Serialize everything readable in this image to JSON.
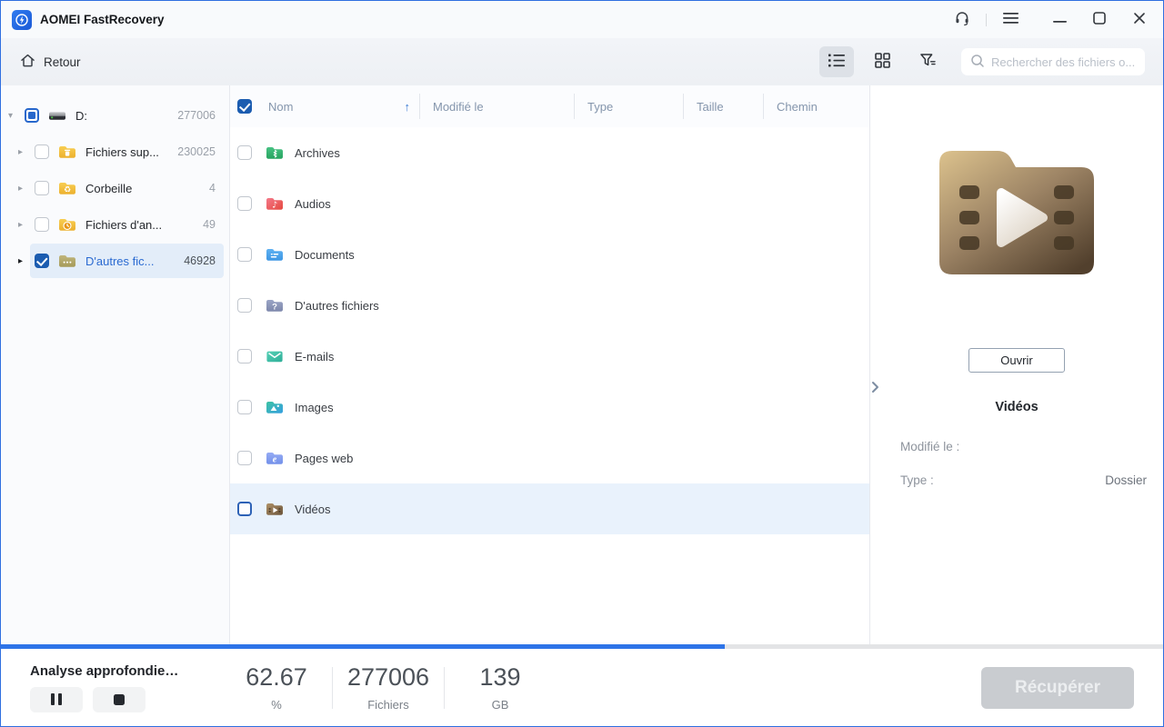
{
  "window": {
    "title": "AOMEI FastRecovery"
  },
  "toolbar": {
    "back_label": "Retour",
    "search_placeholder": "Rechercher des fichiers o..."
  },
  "sidebar": {
    "items": [
      {
        "label": "D:",
        "count": "277006",
        "icon": "drive-icon",
        "checkbox": "indeterminate",
        "expanded": true
      },
      {
        "label": "Fichiers sup...",
        "count": "230025",
        "icon": "deleted-folder-icon",
        "checkbox": "unchecked",
        "expanded": false
      },
      {
        "label": "Corbeille",
        "count": "4",
        "icon": "recycle-folder-icon",
        "checkbox": "unchecked",
        "expanded": false
      },
      {
        "label": "Fichiers d'an...",
        "count": "49",
        "icon": "history-folder-icon",
        "checkbox": "unchecked",
        "expanded": false
      },
      {
        "label": "D'autres fic...",
        "count": "46928",
        "icon": "other-folder-icon",
        "checkbox": "checked",
        "expanded": false,
        "selected": true
      }
    ]
  },
  "list": {
    "columns": {
      "nom": "Nom",
      "modifie": "Modifié le",
      "type": "Type",
      "taille": "Taille",
      "chemin": "Chemin"
    },
    "sort": {
      "column": "Nom",
      "direction": "asc",
      "arrow": "↑"
    },
    "rows": [
      {
        "label": "Archives",
        "icon": "archives-folder-icon"
      },
      {
        "label": "Audios",
        "icon": "audios-folder-icon"
      },
      {
        "label": "Documents",
        "icon": "documents-folder-icon"
      },
      {
        "label": "D'autres fichiers",
        "icon": "other-files-folder-icon"
      },
      {
        "label": "E-mails",
        "icon": "emails-icon"
      },
      {
        "label": "Images",
        "icon": "images-folder-icon"
      },
      {
        "label": "Pages web",
        "icon": "webpages-folder-icon"
      },
      {
        "label": "Vidéos",
        "icon": "videos-folder-icon",
        "selected": true
      }
    ]
  },
  "preview": {
    "open_label": "Ouvrir",
    "title": "Vidéos",
    "modified_label": "Modifié le :",
    "modified_value": "",
    "type_label": "Type :",
    "type_value": "Dossier"
  },
  "statusbar": {
    "scan_label": "Analyse approfondie…",
    "progress_percent": 62.3,
    "stats": [
      {
        "value": "62.67",
        "unit": "%"
      },
      {
        "value": "277006",
        "unit": "Fichiers"
      },
      {
        "value": "139",
        "unit": "GB"
      }
    ],
    "recover_label": "Récupérer",
    "recover_enabled": false
  },
  "colors": {
    "accent": "#2b6de8",
    "window_border": "#2f6fe0",
    "progress_fill": "#2e74e8",
    "selection_bg": "#e9f2fc",
    "checkbox_checked": "#1b5cb0",
    "disabled_button": "#c9ccd0"
  },
  "icons": [
    "app-logo-icon",
    "headset-icon",
    "menu-icon",
    "minimize-icon",
    "maximize-icon",
    "close-icon",
    "home-icon",
    "list-view-icon",
    "grid-view-icon",
    "filter-icon",
    "search-icon",
    "drive-icon",
    "folder-icons",
    "chevron-right-icon",
    "pause-icon",
    "stop-icon",
    "video-folder-preview-icon"
  ]
}
